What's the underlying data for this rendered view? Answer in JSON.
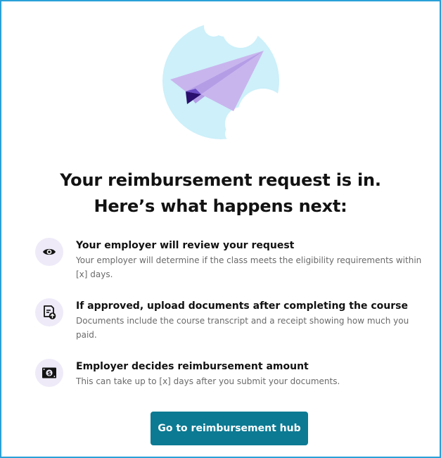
{
  "heading": {
    "line1": "Your reimbursement request is in.",
    "line2": "Here’s what happens next:"
  },
  "steps": [
    {
      "icon": "eye-icon",
      "title": "Your employer will review your request",
      "description": "Your employer will determine if the class meets the eligibility requirements within [x] days."
    },
    {
      "icon": "document-upload-icon",
      "title": "If approved, upload documents after completing the course",
      "description": "Documents include the course transcript and a receipt showing how much you paid."
    },
    {
      "icon": "money-icon",
      "title": "Employer decides reimbursement amount",
      "description": "This can take up to [x] days after you submit your documents."
    }
  ],
  "cta": {
    "label": "Go to reimbursement hub"
  },
  "colors": {
    "frame_border": "#2aa0d8",
    "button_bg": "#0c7a93",
    "icon_circle_bg": "#eeeaf8",
    "illustration_circle": "#cdf0fa",
    "plane_main": "#c9b5ee",
    "plane_dark": "#2a0f6e"
  }
}
